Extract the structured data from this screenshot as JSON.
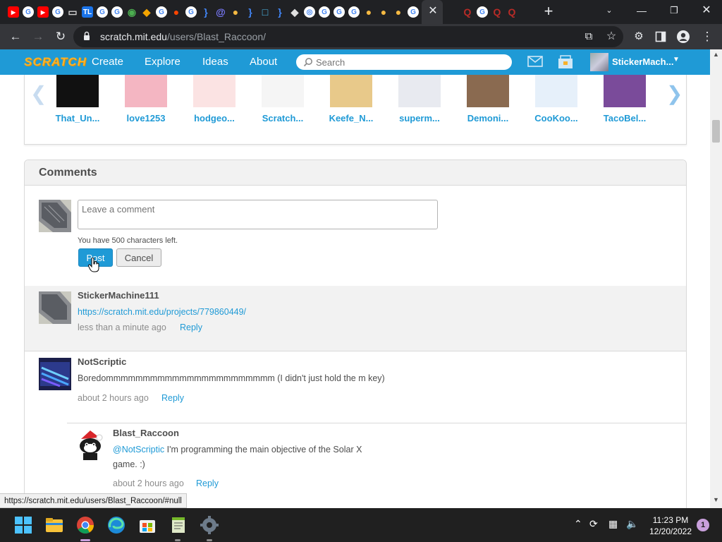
{
  "browser": {
    "tab_favicons": [
      {
        "icon": "youtube-icon",
        "color": "#ff0000"
      },
      {
        "icon": "google-icon",
        "color": "#ffffff"
      },
      {
        "icon": "youtube-icon",
        "color": "#ff0000"
      },
      {
        "icon": "google-icon",
        "color": "#ffffff"
      },
      {
        "icon": "monitor-icon",
        "color": "#d0d0d0"
      },
      {
        "icon": "tl-icon",
        "color": "#1a73e8",
        "label": "TL"
      },
      {
        "icon": "google-icon",
        "color": "#ffffff"
      },
      {
        "icon": "google-icon",
        "color": "#ffffff"
      },
      {
        "icon": "wifi-icon",
        "color": "#4caf50"
      },
      {
        "icon": "fire-icon",
        "color": "#f4a500"
      },
      {
        "icon": "google-icon",
        "color": "#ffffff"
      },
      {
        "icon": "reddit-icon",
        "color": "#ff4500"
      },
      {
        "icon": "google-icon",
        "color": "#ffffff"
      },
      {
        "icon": "braces-icon",
        "color": "#4285f4"
      },
      {
        "icon": "at-icon",
        "color": "#7b7bff"
      },
      {
        "icon": "cookie-icon",
        "color": "#f5b942"
      },
      {
        "icon": "braces-icon",
        "color": "#4285f4"
      },
      {
        "icon": "square-icon",
        "color": "#4fc3f7"
      },
      {
        "icon": "braces-icon",
        "color": "#4285f4"
      },
      {
        "icon": "roblox-icon",
        "color": "#e0e0e0"
      },
      {
        "icon": "chrome-icon",
        "color": "#ffffff"
      },
      {
        "icon": "google-icon",
        "color": "#ffffff"
      },
      {
        "icon": "google-icon",
        "color": "#ffffff"
      },
      {
        "icon": "google-icon",
        "color": "#ffffff"
      },
      {
        "icon": "cookie-icon",
        "color": "#f5b942"
      },
      {
        "icon": "cookie-icon",
        "color": "#f5b942"
      },
      {
        "icon": "cookie-icon",
        "color": "#f5b942"
      },
      {
        "icon": "google-icon",
        "color": "#ffffff"
      },
      {
        "icon": "google-icon",
        "color": "#ffffff"
      },
      {
        "icon": "quora-icon",
        "color": "#b92b27"
      },
      {
        "icon": "google-icon",
        "color": "#ffffff"
      },
      {
        "icon": "quora-icon",
        "color": "#b92b27"
      },
      {
        "icon": "quora-icon",
        "color": "#b92b27"
      }
    ],
    "close_tab": "✕",
    "new_tab": "+",
    "url_host": "scratch.mit.edu",
    "url_path": "/users/Blast_Raccoon/",
    "colors": {
      "chrome_dark": "#202124",
      "chrome_mid": "#35363a"
    }
  },
  "nav": {
    "logo": "SCRATCH",
    "links": [
      "Create",
      "Explore",
      "Ideas",
      "About"
    ],
    "search_placeholder": "Search",
    "username": "StickerMach...",
    "colors": {
      "bar": "#1f9ad6",
      "logo": "#f7b22c"
    }
  },
  "followers": {
    "items": [
      {
        "name": "That_Un...",
        "bg": "#111111"
      },
      {
        "name": "love1253",
        "bg": "#f4b6c2"
      },
      {
        "name": "hodgeo...",
        "bg": "#fbe3e3"
      },
      {
        "name": "Scratch...",
        "bg": "#f5f5f5"
      },
      {
        "name": "Keefe_N...",
        "bg": "#e8c98a"
      },
      {
        "name": "superm...",
        "bg": "#e8eaf0"
      },
      {
        "name": "Demoni...",
        "bg": "#8a6a50"
      },
      {
        "name": "CooKoo...",
        "bg": "#e6f0fa"
      },
      {
        "name": "TacoBel...",
        "bg": "#7a4b9a"
      }
    ]
  },
  "comments": {
    "title": "Comments",
    "placeholder": "Leave a comment",
    "chars_left": "You have 500 characters left.",
    "post_label": "Post",
    "cancel_label": "Cancel",
    "items": [
      {
        "author": "StickerMachine111",
        "link": "https://scratch.mit.edu/projects/779860449/",
        "time": "less than a minute ago",
        "reply": "Reply"
      },
      {
        "author": "NotScriptic",
        "text": "Boredommmmmmmmmmmmmmmmmmmmmmm (I didn't just hold the m key)",
        "time": "about 2 hours ago",
        "reply": "Reply"
      },
      {
        "author": "Blast_Raccoon",
        "mention": "@NotScriptic",
        "text": " I'm programming the main objective of the Solar X game. :)",
        "time": "about 2 hours ago",
        "reply": "Reply"
      }
    ]
  },
  "status_url": "https://scratch.mit.edu/users/Blast_Raccoon/#null",
  "taskbar": {
    "time": "11:23 PM",
    "date": "12/20/2022",
    "notifications": "1"
  }
}
